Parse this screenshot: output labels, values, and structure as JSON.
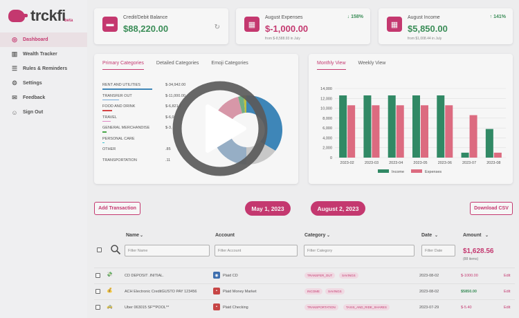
{
  "brand": {
    "name": "trckfi",
    "beta": "beta"
  },
  "nav": [
    {
      "label": "Dashboard",
      "icon": "dashboard-icon"
    },
    {
      "label": "Wealth Tracker",
      "icon": "chart-icon"
    },
    {
      "label": "Rules & Reminders",
      "icon": "sliders-icon"
    },
    {
      "label": "Settings",
      "icon": "gear-icon"
    },
    {
      "label": "Feedback",
      "icon": "chat-icon"
    },
    {
      "label": "Sign Out",
      "icon": "users-icon"
    }
  ],
  "stats": {
    "balance": {
      "title": "Credit/Debit Balance",
      "value": "$88,220.00"
    },
    "expenses": {
      "title": "August Expenses",
      "value": "$-1,000.00",
      "sub": "from $-8,588.93 in July",
      "change": "↓ 158%"
    },
    "income": {
      "title": "August Income",
      "value": "$5,850.00",
      "sub": "from $1,008.44 in July",
      "change": "↑ 141%"
    }
  },
  "categories_card": {
    "tabs": [
      "Primary Categories",
      "Detailed Categories",
      "Emoji Categories"
    ],
    "items": [
      {
        "name": "RENT AND UTILITIES",
        "amount": "$-34,942.00",
        "color": "#1f77b4"
      },
      {
        "name": "TRANSFER OUT",
        "amount": "$-11,000.00",
        "color": "#5fa2dd"
      },
      {
        "name": "FOOD AND DRINK",
        "amount": "$-6,821.7",
        "color": "#d62728"
      },
      {
        "name": "TRAVEL",
        "amount": "$-6,0",
        "color": "#e377c2"
      },
      {
        "name": "GENERAL MERCHANDISE",
        "amount": "$-3,",
        "color": "#2ca02c"
      },
      {
        "name": "PERSONAL CARE",
        "amount": "",
        "color": "#17becf"
      },
      {
        "name": "OTHER",
        "amount": ".85",
        "color": "#bcbd22"
      },
      {
        "name": "TRANSPORTATION",
        "amount": ".11",
        "color": "#8c564b"
      }
    ]
  },
  "monthly_card": {
    "tabs": [
      "Monthly View",
      "Weekly View"
    ]
  },
  "chart_data": {
    "type": "bar",
    "categories": [
      "2023-02",
      "2023-03",
      "2023-04",
      "2023-05",
      "2023-06",
      "2023-07",
      "2023-08"
    ],
    "series": [
      {
        "name": "Income",
        "values": [
          12600,
          12600,
          12600,
          12600,
          12600,
          1000,
          5800
        ],
        "color": "#0f7a4f"
      },
      {
        "name": "Expenses",
        "values": [
          10600,
          10600,
          10600,
          10600,
          10600,
          8600,
          1000
        ],
        "color": "#e0566f"
      }
    ],
    "ylim": [
      0,
      14000
    ],
    "yticks": [
      "14,000",
      "12,000",
      "10,000",
      "8,000",
      "6,000",
      "4,000",
      "2,000",
      "0"
    ],
    "legend": "bottom",
    "grid": true
  },
  "actions": {
    "add": "Add Transaction",
    "start_date": "May 1, 2023",
    "end_date": "August 2, 2023",
    "download": "Download CSV"
  },
  "table": {
    "headers": {
      "name": "Name",
      "account": "Account",
      "category": "Category",
      "date": "Date",
      "amount": "Amount"
    },
    "filters": {
      "name": "Filter Name",
      "account": "Filter Account",
      "category": "Filter Category",
      "date": "Filter Date"
    },
    "total": "$1,628.56",
    "total_count": "(88 items)",
    "rows": [
      {
        "name": "CD DEPOSIT .INITIAL.",
        "account": "Plaid CD",
        "badges": [
          "TRANSFER_OUT",
          "SAVINGS"
        ],
        "date": "2023-08-02",
        "amount": "$-1000.00",
        "action": "Edit"
      },
      {
        "name": "ACH Electronic CreditGUSTO PAY 123456",
        "account": "Plaid Money Market",
        "badges": [
          "INCOME",
          "SAVINGS"
        ],
        "date": "2023-08-02",
        "amount": "$5850.00",
        "action": "Edit"
      },
      {
        "name": "Uber 063015 SF**POOL**",
        "account": "Plaid Checking",
        "badges": [
          "TRANSPORTATION",
          "TAXIS_AND_RIDE_SHARES"
        ],
        "date": "2023-07-29",
        "amount": "$-5.40",
        "action": "Edit"
      }
    ]
  }
}
